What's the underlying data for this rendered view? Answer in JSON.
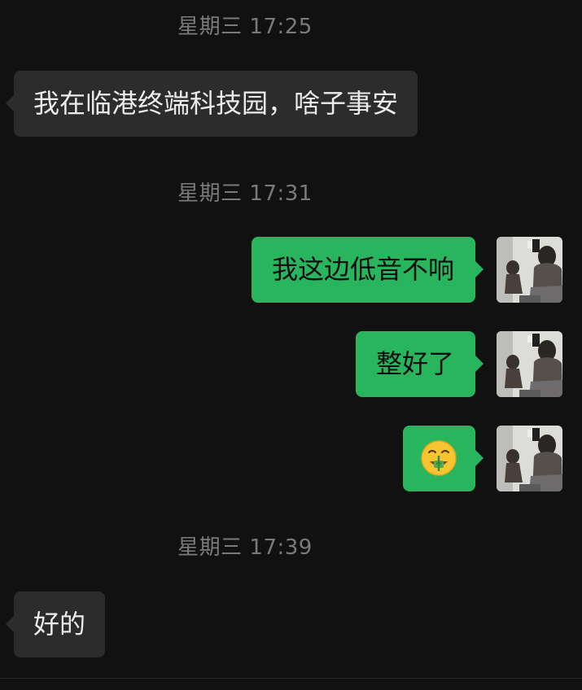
{
  "chat": {
    "messages": [
      {
        "type": "timestamp",
        "text": "星期三 17:25"
      },
      {
        "type": "incoming",
        "text": "我在临港终端科技园，啥子事安"
      },
      {
        "type": "timestamp",
        "text": "星期三 17:31"
      },
      {
        "type": "outgoing",
        "text": "我这边低音不响"
      },
      {
        "type": "outgoing",
        "text": "整好了"
      },
      {
        "type": "outgoing",
        "emoji": "money-mouth-face-icon"
      },
      {
        "type": "timestamp",
        "text": "星期三 17:39"
      },
      {
        "type": "incoming",
        "text": "好的"
      }
    ]
  },
  "colors": {
    "background": "#111111",
    "incoming_bubble": "#2c2c2c",
    "outgoing_bubble": "#29b45e",
    "timestamp_text": "#7a7a7a"
  }
}
